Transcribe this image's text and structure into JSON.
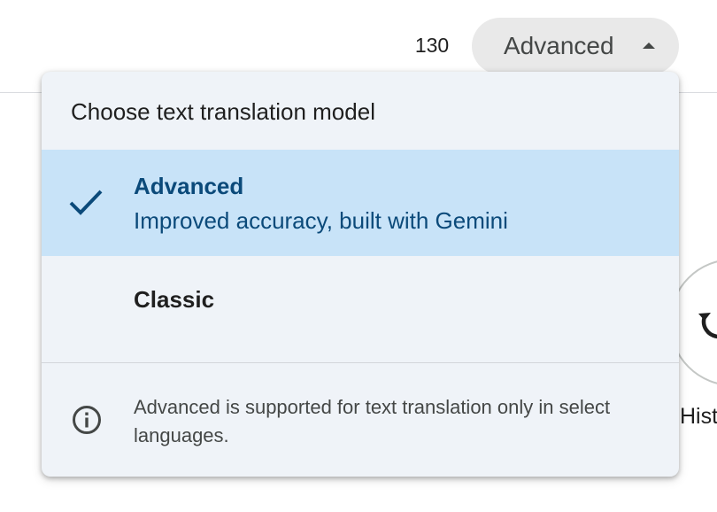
{
  "header": {
    "char_count": "130",
    "model_toggle_label": "Advanced"
  },
  "model_menu": {
    "title": "Choose text translation model",
    "options": [
      {
        "title": "Advanced",
        "subtitle": "Improved accuracy, built with Gemini",
        "selected": true
      },
      {
        "title": "Classic",
        "selected": false
      }
    ],
    "info_text": "Advanced is supported for text translation only in select languages."
  },
  "side": {
    "history_label": "Hist"
  },
  "colors": {
    "selected_bg": "#c8e3f8",
    "selected_text": "#0b4a7a",
    "menu_bg": "#eff3f8",
    "toggle_bg": "#e9e9e9"
  },
  "icons": {
    "check": "check-icon",
    "caret": "caret-up-icon",
    "info": "info-icon",
    "history": "history-icon"
  }
}
